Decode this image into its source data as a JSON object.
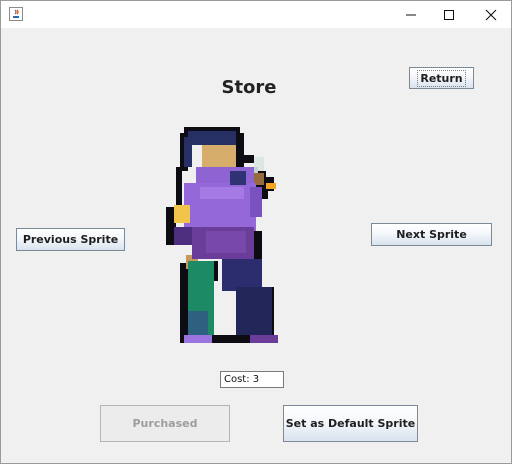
{
  "window": {
    "app_icon": "java-icon",
    "controls": [
      "minimize-icon",
      "maximize-icon",
      "close-icon"
    ]
  },
  "store": {
    "title": "Store",
    "return_label": "Return",
    "previous_label": "Previous Sprite",
    "next_label": "Next Sprite",
    "cost_text": "Cost: 3",
    "purchased_label": "Purchased",
    "default_label": "Set as Default Sprite"
  }
}
